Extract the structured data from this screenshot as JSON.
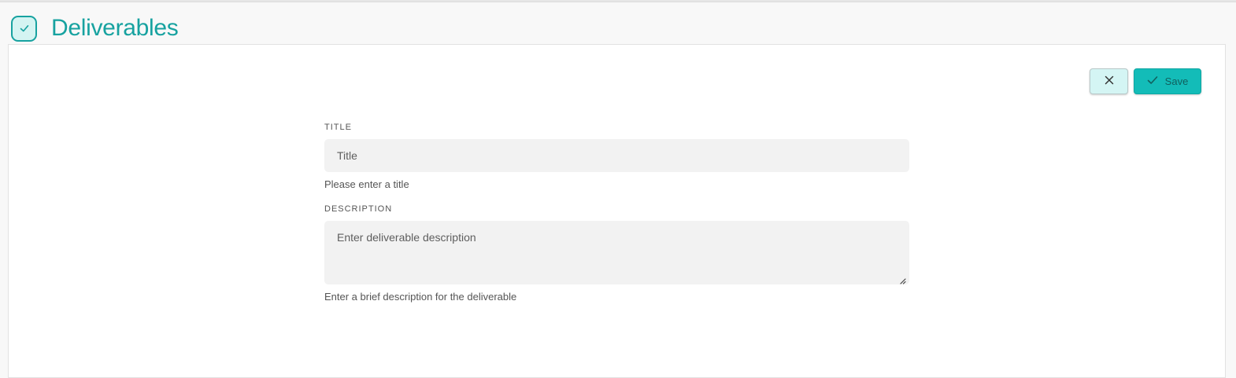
{
  "header": {
    "title": "Deliverables",
    "icon": "check-icon"
  },
  "toolbar": {
    "cancel_icon": "close-icon",
    "save_icon": "check-icon",
    "save_label": "Save"
  },
  "form": {
    "title_field": {
      "label": "TITLE",
      "value": "",
      "placeholder": "Title",
      "helper": "Please enter a title"
    },
    "description_field": {
      "label": "DESCRIPTION",
      "value": "",
      "placeholder": "Enter deliverable description",
      "helper": "Enter a brief description for the deliverable"
    }
  },
  "colors": {
    "accent": "#17a2a0",
    "save_button": "#13bcb8",
    "cancel_button": "#d4f5f4",
    "input_background": "#f2f2f2"
  }
}
